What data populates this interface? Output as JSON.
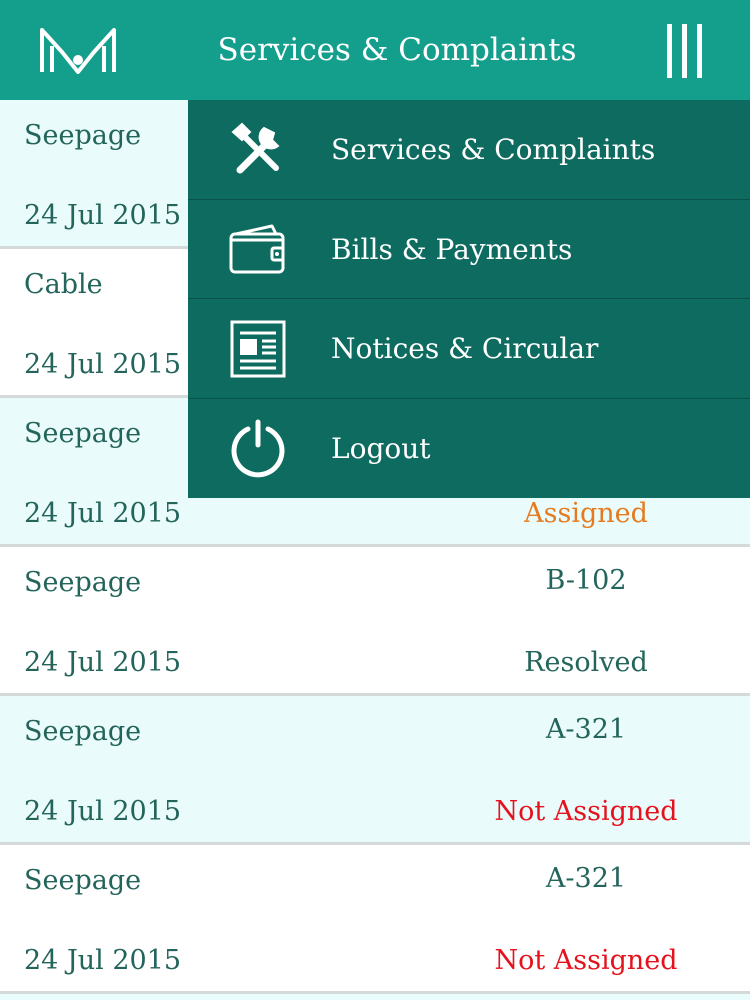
{
  "header": {
    "title": "Services & Complaints",
    "logo_icon": "m-logo-icon",
    "menu_icon": "hamburger-menu-icon"
  },
  "drawer": {
    "items": [
      {
        "label": "Services & Complaints",
        "icon": "tools-icon"
      },
      {
        "label": "Bills & Payments",
        "icon": "wallet-icon"
      },
      {
        "label": "Notices & Circular",
        "icon": "notice-icon"
      },
      {
        "label": "Logout",
        "icon": "power-icon"
      }
    ]
  },
  "complaints": [
    {
      "category": "Seepage",
      "date": "24 Jul 2015",
      "unit": "",
      "status": ""
    },
    {
      "category": "Cable",
      "date": "24 Jul 2015",
      "unit": "",
      "status": ""
    },
    {
      "category": "Seepage",
      "date": "24 Jul 2015",
      "unit": "",
      "status": "Assigned"
    },
    {
      "category": "Seepage",
      "date": "24 Jul 2015",
      "unit": "B-102",
      "status": "Resolved"
    },
    {
      "category": "Seepage",
      "date": "24 Jul 2015",
      "unit": "A-321",
      "status": "Not Assigned"
    },
    {
      "category": "Seepage",
      "date": "24 Jul 2015",
      "unit": "A-321",
      "status": "Not Assigned"
    }
  ],
  "colors": {
    "header": "#149f8d",
    "drawer": "#0e6b5f",
    "text": "#23645b",
    "assigned": "#e57b1e",
    "not_assigned": "#e5121d"
  }
}
